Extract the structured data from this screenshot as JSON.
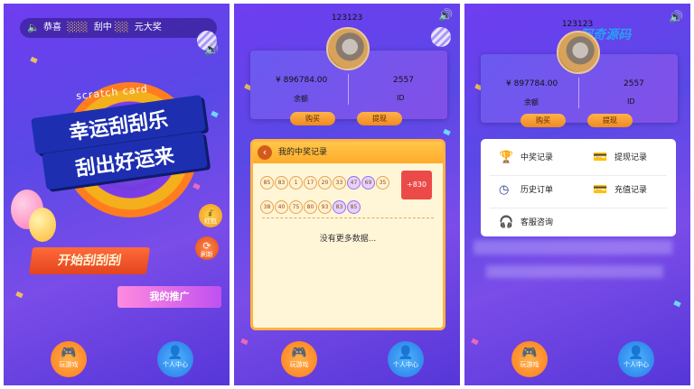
{
  "screen1": {
    "marquee_text_a": "恭喜",
    "marquee_text_b": "刮中",
    "marquee_text_c": "元大奖",
    "scratch_label": "scratch card",
    "title_line1": "幸运刮刮乐",
    "title_line2": "刮出好运来",
    "start_button": "开始刮刮刮",
    "share_button": "我的推广",
    "side_icon_top": "红包",
    "side_icon_bottom": "刷新"
  },
  "screen2": {
    "user_id_top": "123123",
    "balance": "¥ 896784.00",
    "balance_label": "余额",
    "id_value": "2557",
    "id_label": "ID",
    "buy_button": "购买",
    "withdraw_button": "提现",
    "records_title": "我的中奖记录",
    "numbers": [
      "85",
      "83",
      "1",
      "17",
      "20",
      "33",
      "47",
      "69",
      "35",
      "38",
      "40",
      "75",
      "80",
      "93",
      "83",
      "85"
    ],
    "highlighted": [
      6,
      7,
      14,
      15
    ],
    "win_amount": "+830",
    "no_more_text": "没有更多数据..."
  },
  "screen3": {
    "user_id_top": "123123",
    "balance": "¥ 897784.00",
    "balance_label": "余额",
    "id_value": "2557",
    "id_label": "ID",
    "buy_button": "购买",
    "withdraw_button": "提现",
    "watermark": "阿奇源码",
    "menu": {
      "winning_records": "中奖记录",
      "withdraw_records": "提现记录",
      "order_history": "历史订单",
      "recharge_records": "充值记录",
      "customer_service": "客服咨询"
    }
  },
  "nav": {
    "play_game": "玩游戏",
    "personal_center": "个人中心"
  },
  "colors": {
    "background": "#6f3df0",
    "accent_orange": "#ffab2a",
    "win_red": "#ec4a48",
    "button_orange": "#f08a20"
  }
}
